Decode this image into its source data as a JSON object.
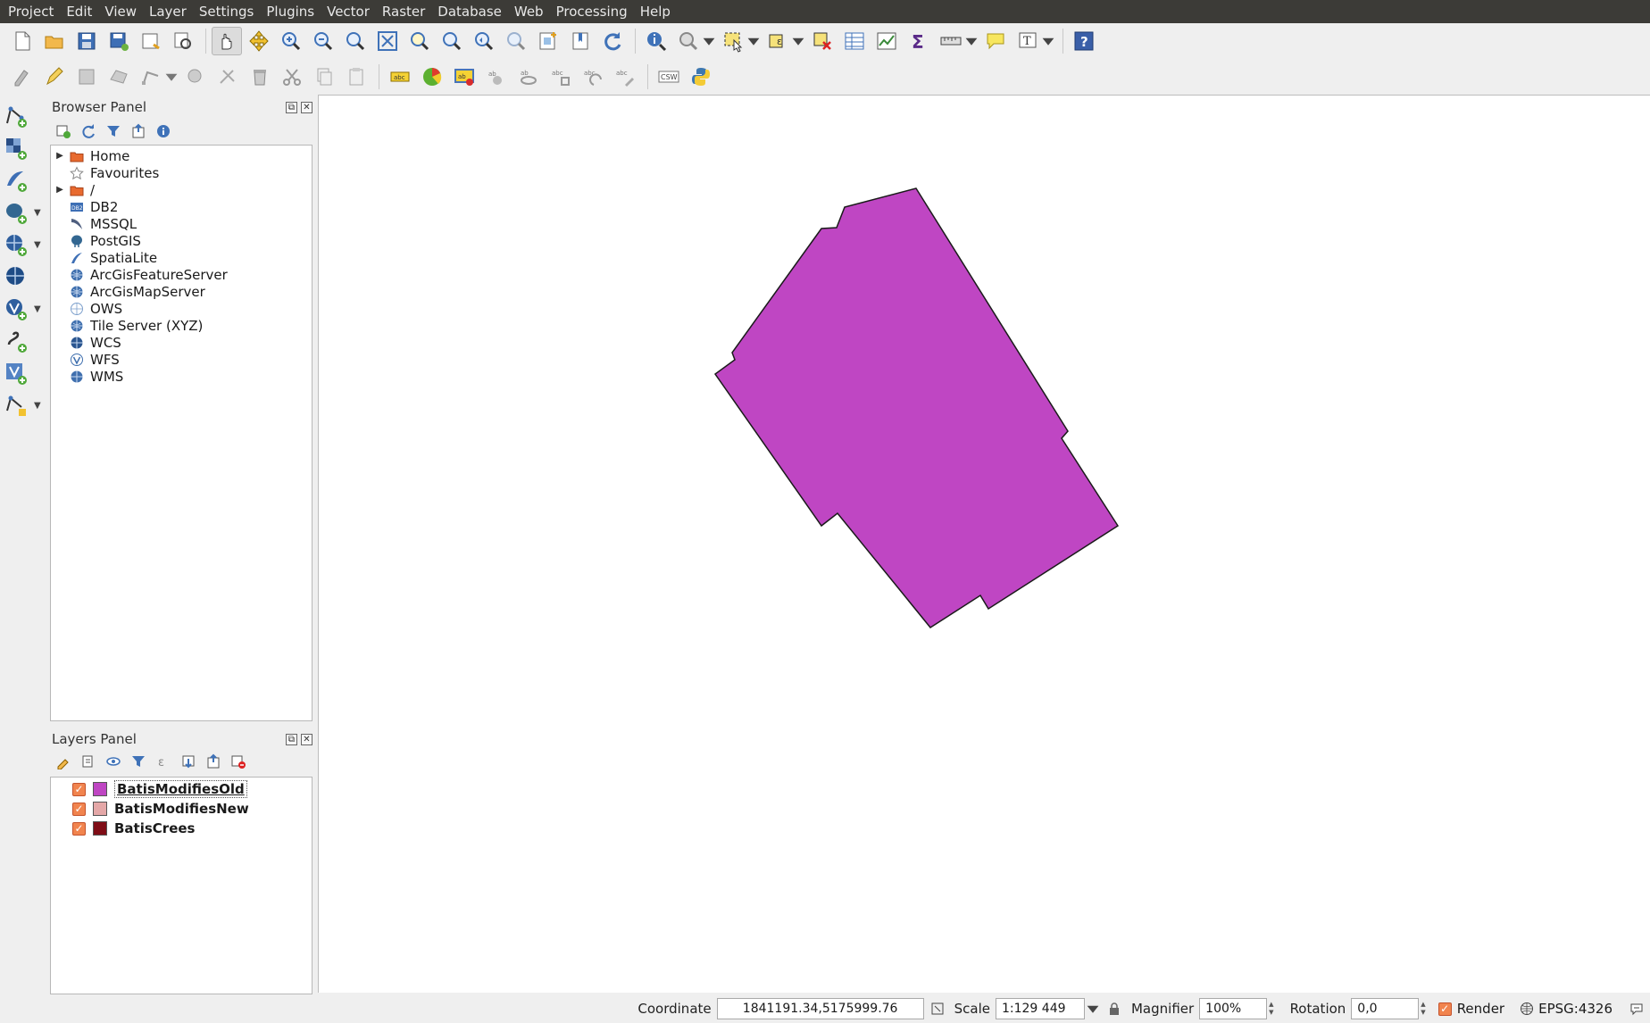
{
  "menu": [
    "Project",
    "Edit",
    "View",
    "Layer",
    "Settings",
    "Plugins",
    "Vector",
    "Raster",
    "Database",
    "Web",
    "Processing",
    "Help"
  ],
  "browser_panel": {
    "title": "Browser Panel",
    "items": [
      {
        "label": "Home",
        "icon": "folder-icon",
        "expandable": true
      },
      {
        "label": "Favourites",
        "icon": "star-icon",
        "expandable": false
      },
      {
        "label": "/",
        "icon": "folder-icon",
        "expandable": true
      },
      {
        "label": "DB2",
        "icon": "db2-icon",
        "expandable": false
      },
      {
        "label": "MSSQL",
        "icon": "mssql-icon",
        "expandable": false
      },
      {
        "label": "PostGIS",
        "icon": "postgis-icon",
        "expandable": false
      },
      {
        "label": "SpatiaLite",
        "icon": "spatialite-icon",
        "expandable": false
      },
      {
        "label": "ArcGisFeatureServer",
        "icon": "globe-icon",
        "expandable": false
      },
      {
        "label": "ArcGisMapServer",
        "icon": "globe-icon",
        "expandable": false
      },
      {
        "label": "OWS",
        "icon": "ows-icon",
        "expandable": false
      },
      {
        "label": "Tile Server (XYZ)",
        "icon": "globe-icon",
        "expandable": false
      },
      {
        "label": "WCS",
        "icon": "wcs-icon",
        "expandable": false
      },
      {
        "label": "WFS",
        "icon": "wfs-icon",
        "expandable": false
      },
      {
        "label": "WMS",
        "icon": "wms-icon",
        "expandable": false
      }
    ]
  },
  "layers_panel": {
    "title": "Layers Panel",
    "layers": [
      {
        "name": "BatisModifiesOld",
        "color": "#bf46c3",
        "checked": true,
        "selected": true
      },
      {
        "name": "BatisModifiesNew",
        "color": "#e4a7a7",
        "checked": true,
        "selected": false
      },
      {
        "name": "BatisCrees",
        "color": "#7f0d16",
        "checked": true,
        "selected": false
      }
    ]
  },
  "map": {
    "polygon_fill": "#bf46c3",
    "polygon_stroke": "#1a1a1a",
    "background": "#ffffff"
  },
  "status": {
    "coordinate_label": "Coordinate",
    "coordinate_value": "1841191.34,5175999.76",
    "scale_label": "Scale",
    "scale_value": "1:129 449",
    "magnifier_label": "Magnifier",
    "magnifier_value": "100%",
    "rotation_label": "Rotation",
    "rotation_value": "0,0",
    "render_label": "Render",
    "crs_label": "EPSG:4326"
  },
  "colors": {
    "accent_checkbox": "#f1844e",
    "menubar": "#3c3b37"
  }
}
